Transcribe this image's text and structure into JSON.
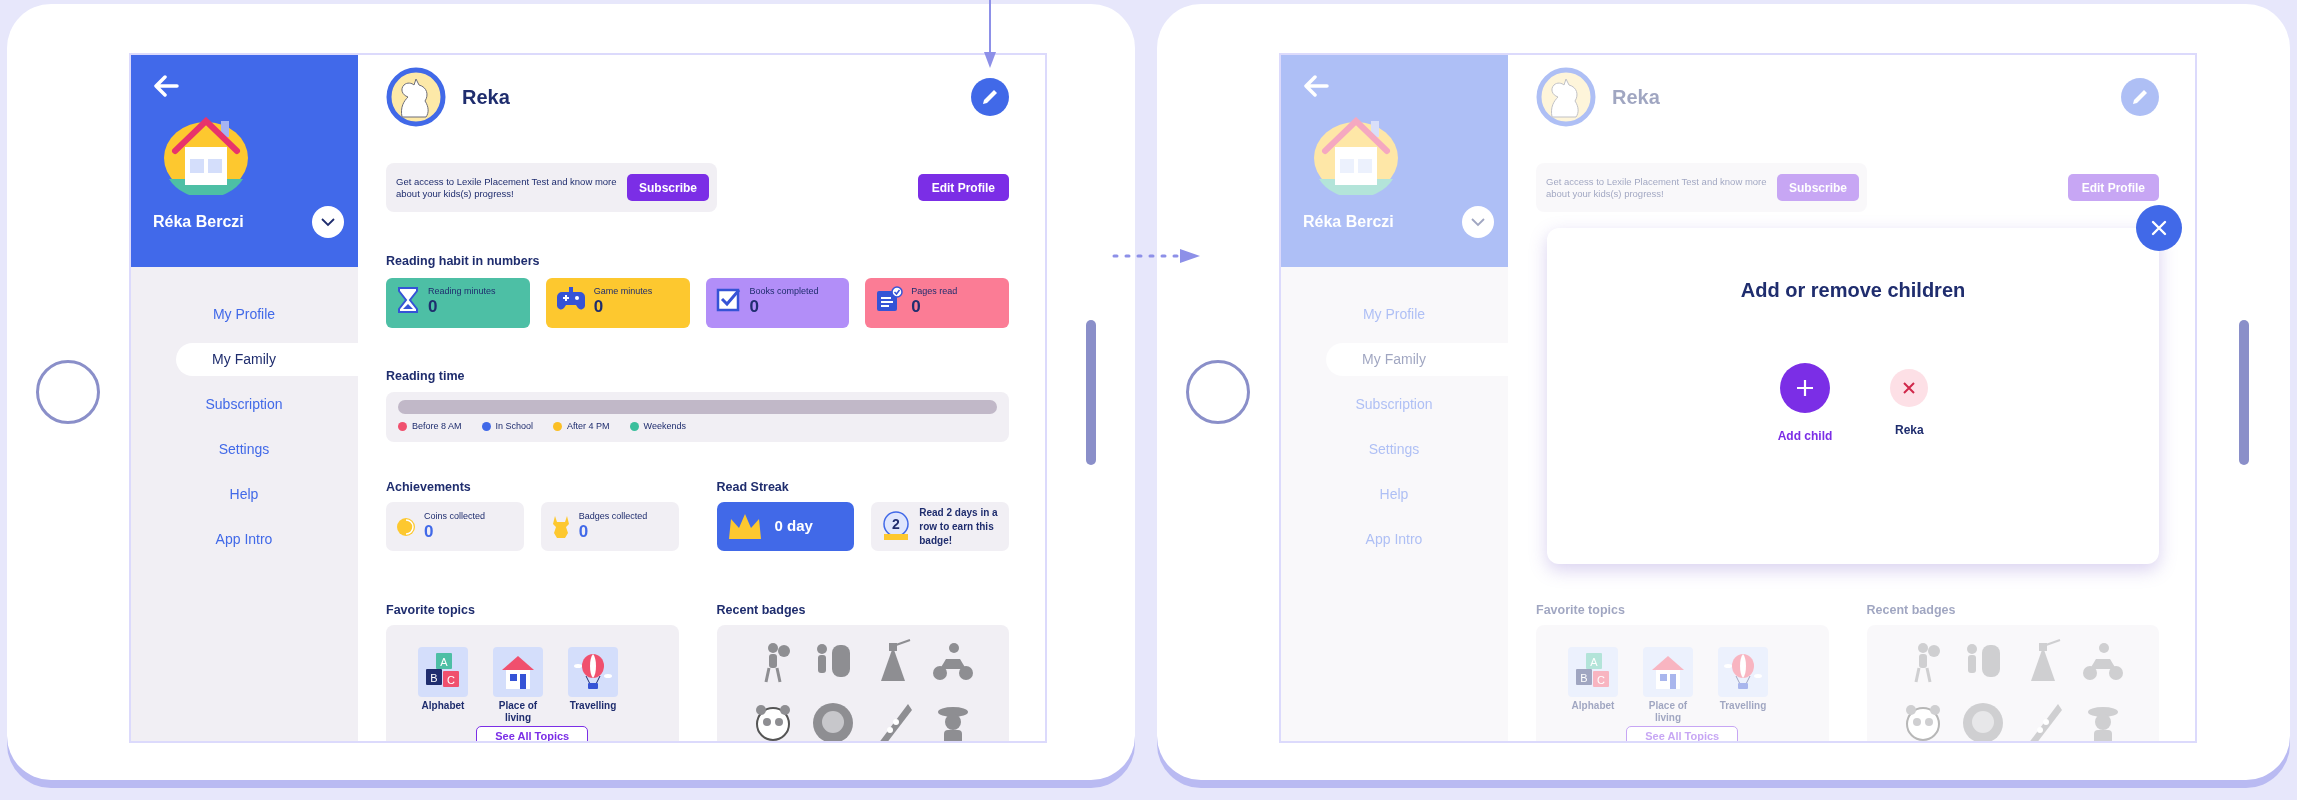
{
  "screens": [
    {
      "sidebar": {
        "profile_name": "Réka Berczi",
        "menu": [
          {
            "label": "My Profile",
            "selected": false
          },
          {
            "label": "My Family",
            "selected": true
          },
          {
            "label": "Subscription",
            "selected": false
          },
          {
            "label": "Settings",
            "selected": false
          },
          {
            "label": "Help",
            "selected": false
          },
          {
            "label": "App Intro",
            "selected": false
          }
        ]
      },
      "child_name": "Reka",
      "banner": {
        "text": "Get access to Lexile Placement Test and know more about your kids(s) progress!",
        "button": "Subscribe"
      },
      "edit_button": "Edit Profile",
      "reading_habit": {
        "title": "Reading habit in numbers",
        "stats": [
          {
            "kind": "reading",
            "label": "Reading minutes",
            "value": "0",
            "color": "#4dbfa5"
          },
          {
            "kind": "game",
            "label": "Game minutes",
            "value": "0",
            "color": "#fdc82f"
          },
          {
            "kind": "books",
            "label": "Books completed",
            "value": "0",
            "color": "#b28ef8"
          },
          {
            "kind": "pages",
            "label": "Pages read",
            "value": "0",
            "color": "#fb7c95"
          }
        ]
      },
      "reading_time": {
        "title": "Reading time",
        "legend": [
          {
            "label": "Before 8 AM",
            "color": "#f0506e"
          },
          {
            "label": "In School",
            "color": "#4169e8"
          },
          {
            "label": "After 4 PM",
            "color": "#fbbf24"
          },
          {
            "label": "Weekends",
            "color": "#3bbf9c"
          }
        ]
      },
      "achievements": {
        "title": "Achievements",
        "items": [
          {
            "kind": "coins",
            "label": "Coins collected",
            "value": "0"
          },
          {
            "kind": "badges",
            "label": "Badges collected",
            "value": "0"
          }
        ]
      },
      "read_streak": {
        "title": "Read Streak",
        "streak": "0 day",
        "badge_number": "2",
        "badge_text": "Read 2 days in a row to earn this badge!"
      },
      "favorite_topics": {
        "title": "Favorite topics",
        "topics": [
          {
            "kind": "alphabet",
            "label": "Alphabet",
            "letters": [
              "A",
              "B",
              "C"
            ]
          },
          {
            "kind": "home",
            "label": "Place of living"
          },
          {
            "kind": "balloon",
            "label": "Travelling"
          }
        ],
        "button": "See All Topics"
      },
      "recent_badges": {
        "title": "Recent badges"
      }
    },
    {
      "sidebar": {
        "profile_name": "Réka Berczi",
        "menu": [
          {
            "label": "My Profile",
            "selected": false
          },
          {
            "label": "My Family",
            "selected": true
          },
          {
            "label": "Subscription",
            "selected": false
          },
          {
            "label": "Settings",
            "selected": false
          },
          {
            "label": "Help",
            "selected": false
          },
          {
            "label": "App Intro",
            "selected": false
          }
        ]
      },
      "child_name": "Reka",
      "banner": {
        "text": "Get access to Lexile Placement Test and know more about your kids(s) progress!",
        "button": "Subscribe"
      },
      "edit_button": "Edit Profile",
      "modal": {
        "title": "Add or remove children",
        "add_label": "Add child",
        "children": [
          {
            "name": "Reka"
          }
        ]
      },
      "favorite_topics": {
        "title": "Favorite topics",
        "topics": [
          {
            "kind": "alphabet",
            "label": "Alphabet",
            "letters": [
              "A",
              "B",
              "C"
            ]
          },
          {
            "kind": "home",
            "label": "Place of living"
          },
          {
            "kind": "balloon",
            "label": "Travelling"
          }
        ],
        "button": "See All Topics"
      },
      "recent_badges": {
        "title": "Recent badges"
      }
    }
  ]
}
